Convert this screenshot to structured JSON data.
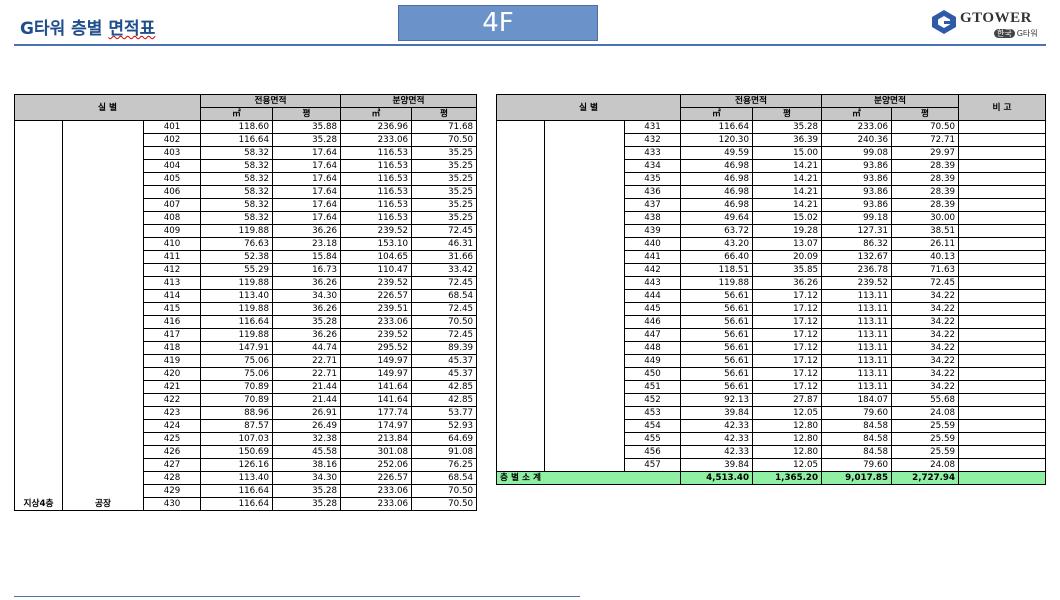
{
  "header": {
    "title_prefix": "G타워 층별 ",
    "title_underlined": "면적표",
    "floor": "4F",
    "logo_word": "GTOWER",
    "logo_chip": "한국",
    "logo_sub": "G타워"
  },
  "table_headers": {
    "room": "실        별",
    "exclusive": "전용면적",
    "sale": "분양면적",
    "remark": "비  고",
    "sqm": "㎡",
    "pyeong": "평"
  },
  "left_table": {
    "floor_label": "지상4층",
    "use_label": "공장",
    "rows": [
      [
        "401",
        "118.60",
        "35.88",
        "236.96",
        "71.68"
      ],
      [
        "402",
        "116.64",
        "35.28",
        "233.06",
        "70.50"
      ],
      [
        "403",
        "58.32",
        "17.64",
        "116.53",
        "35.25"
      ],
      [
        "404",
        "58.32",
        "17.64",
        "116.53",
        "35.25"
      ],
      [
        "405",
        "58.32",
        "17.64",
        "116.53",
        "35.25"
      ],
      [
        "406",
        "58.32",
        "17.64",
        "116.53",
        "35.25"
      ],
      [
        "407",
        "58.32",
        "17.64",
        "116.53",
        "35.25"
      ],
      [
        "408",
        "58.32",
        "17.64",
        "116.53",
        "35.25"
      ],
      [
        "409",
        "119.88",
        "36.26",
        "239.52",
        "72.45"
      ],
      [
        "410",
        "76.63",
        "23.18",
        "153.10",
        "46.31"
      ],
      [
        "411",
        "52.38",
        "15.84",
        "104.65",
        "31.66"
      ],
      [
        "412",
        "55.29",
        "16.73",
        "110.47",
        "33.42"
      ],
      [
        "413",
        "119.88",
        "36.26",
        "239.52",
        "72.45"
      ],
      [
        "414",
        "113.40",
        "34.30",
        "226.57",
        "68.54"
      ],
      [
        "415",
        "119.88",
        "36.26",
        "239.51",
        "72.45"
      ],
      [
        "416",
        "116.64",
        "35.28",
        "233.06",
        "70.50"
      ],
      [
        "417",
        "119.88",
        "36.26",
        "239.52",
        "72.45"
      ],
      [
        "418",
        "147.91",
        "44.74",
        "295.52",
        "89.39"
      ],
      [
        "419",
        "75.06",
        "22.71",
        "149.97",
        "45.37"
      ],
      [
        "420",
        "75.06",
        "22.71",
        "149.97",
        "45.37"
      ],
      [
        "421",
        "70.89",
        "21.44",
        "141.64",
        "42.85"
      ],
      [
        "422",
        "70.89",
        "21.44",
        "141.64",
        "42.85"
      ],
      [
        "423",
        "88.96",
        "26.91",
        "177.74",
        "53.77"
      ],
      [
        "424",
        "87.57",
        "26.49",
        "174.97",
        "52.93"
      ],
      [
        "425",
        "107.03",
        "32.38",
        "213.84",
        "64.69"
      ],
      [
        "426",
        "150.69",
        "45.58",
        "301.08",
        "91.08"
      ],
      [
        "427",
        "126.16",
        "38.16",
        "252.06",
        "76.25"
      ],
      [
        "428",
        "113.40",
        "34.30",
        "226.57",
        "68.54"
      ],
      [
        "429",
        "116.64",
        "35.28",
        "233.06",
        "70.50"
      ],
      [
        "430",
        "116.64",
        "35.28",
        "233.06",
        "70.50"
      ]
    ]
  },
  "right_table": {
    "rows": [
      [
        "431",
        "116.64",
        "35.28",
        "233.06",
        "70.50"
      ],
      [
        "432",
        "120.30",
        "36.39",
        "240.36",
        "72.71"
      ],
      [
        "433",
        "49.59",
        "15.00",
        "99.08",
        "29.97"
      ],
      [
        "434",
        "46.98",
        "14.21",
        "93.86",
        "28.39"
      ],
      [
        "435",
        "46.98",
        "14.21",
        "93.86",
        "28.39"
      ],
      [
        "436",
        "46.98",
        "14.21",
        "93.86",
        "28.39"
      ],
      [
        "437",
        "46.98",
        "14.21",
        "93.86",
        "28.39"
      ],
      [
        "438",
        "49.64",
        "15.02",
        "99.18",
        "30.00"
      ],
      [
        "439",
        "63.72",
        "19.28",
        "127.31",
        "38.51"
      ],
      [
        "440",
        "43.20",
        "13.07",
        "86.32",
        "26.11"
      ],
      [
        "441",
        "66.40",
        "20.09",
        "132.67",
        "40.13"
      ],
      [
        "442",
        "118.51",
        "35.85",
        "236.78",
        "71.63"
      ],
      [
        "443",
        "119.88",
        "36.26",
        "239.52",
        "72.45"
      ],
      [
        "444",
        "56.61",
        "17.12",
        "113.11",
        "34.22"
      ],
      [
        "445",
        "56.61",
        "17.12",
        "113.11",
        "34.22"
      ],
      [
        "446",
        "56.61",
        "17.12",
        "113.11",
        "34.22"
      ],
      [
        "447",
        "56.61",
        "17.12",
        "113.11",
        "34.22"
      ],
      [
        "448",
        "56.61",
        "17.12",
        "113.11",
        "34.22"
      ],
      [
        "449",
        "56.61",
        "17.12",
        "113.11",
        "34.22"
      ],
      [
        "450",
        "56.61",
        "17.12",
        "113.11",
        "34.22"
      ],
      [
        "451",
        "56.61",
        "17.12",
        "113.11",
        "34.22"
      ],
      [
        "452",
        "92.13",
        "27.87",
        "184.07",
        "55.68"
      ],
      [
        "453",
        "39.84",
        "12.05",
        "79.60",
        "24.08"
      ],
      [
        "454",
        "42.33",
        "12.80",
        "84.58",
        "25.59"
      ],
      [
        "455",
        "42.33",
        "12.80",
        "84.58",
        "25.59"
      ],
      [
        "456",
        "42.33",
        "12.80",
        "84.58",
        "25.59"
      ],
      [
        "457",
        "39.84",
        "12.05",
        "79.60",
        "24.08"
      ]
    ],
    "subtotal": {
      "label": "층 별 소 계",
      "values": [
        "4,513.40",
        "1,365.20",
        "9,017.85",
        "2,727.94"
      ]
    }
  },
  "colors": {
    "title": "#1f4e8c",
    "header_bg": "#c7c7c7",
    "subtotal_bg": "#8ff0a4",
    "floor_badge": "#6c93c9"
  }
}
